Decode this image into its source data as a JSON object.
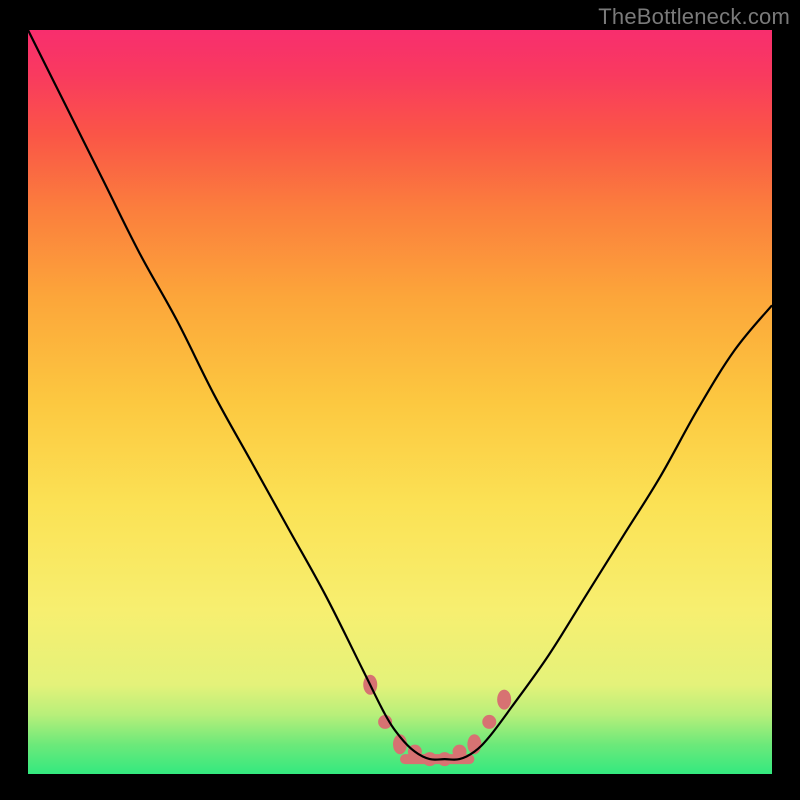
{
  "attribution": "TheBottleneck.com",
  "chart_data": {
    "type": "line",
    "title": "",
    "xlabel": "",
    "ylabel": "",
    "xlim": [
      0,
      100
    ],
    "ylim": [
      0,
      100
    ],
    "grid": false,
    "legend": false,
    "gradient_meaning": "bottleneck severity (green low to red high)",
    "series": [
      {
        "name": "bottleneck-curve",
        "color": "#000000",
        "x": [
          0,
          5,
          10,
          15,
          20,
          25,
          30,
          35,
          40,
          45,
          48,
          50,
          52,
          54,
          56,
          58,
          60,
          62,
          65,
          70,
          75,
          80,
          85,
          90,
          95,
          100
        ],
        "y": [
          100,
          90,
          80,
          70,
          61,
          51,
          42,
          33,
          24,
          14,
          8,
          5,
          3,
          2,
          2,
          2,
          3,
          5,
          9,
          16,
          24,
          32,
          40,
          49,
          57,
          63
        ]
      }
    ],
    "markers": {
      "name": "highlight-points",
      "color": "#d77272",
      "points": [
        {
          "x": 46,
          "y": 12
        },
        {
          "x": 48,
          "y": 7
        },
        {
          "x": 50,
          "y": 4
        },
        {
          "x": 52,
          "y": 3
        },
        {
          "x": 54,
          "y": 2
        },
        {
          "x": 56,
          "y": 2
        },
        {
          "x": 58,
          "y": 3
        },
        {
          "x": 60,
          "y": 4
        },
        {
          "x": 62,
          "y": 7
        },
        {
          "x": 64,
          "y": 10
        }
      ]
    }
  }
}
